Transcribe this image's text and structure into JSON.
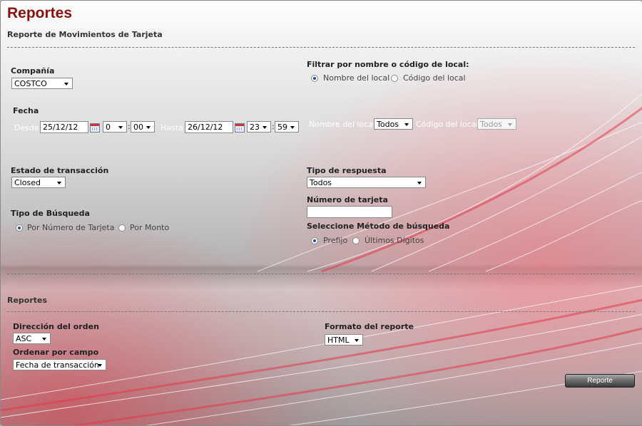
{
  "page": {
    "title": "Reportes",
    "subtitle": "Reporte de Movimientos de Tarjeta"
  },
  "company": {
    "label": "Compañía",
    "value": "COSTCO"
  },
  "local_filter": {
    "label": "Filtrar por nombre o código de local:",
    "options": [
      "Nombre del local",
      "Código del local"
    ],
    "selected": "Nombre del local",
    "name_label": "Nombre del local",
    "name_value": "Todos",
    "code_label": "Código del local",
    "code_value": "Todos"
  },
  "date": {
    "label": "Fecha",
    "from_label": "Desde",
    "from_date": "25/12/12",
    "from_hour": "0",
    "from_min": "00",
    "to_label": "Hasta",
    "to_date": "26/12/12",
    "to_hour": "23",
    "to_min": "59",
    "separator": ":"
  },
  "transaction_state": {
    "label": "Estado de transacción",
    "value": "Closed"
  },
  "response_type": {
    "label": "Tipo de respuesta",
    "value": "Todos"
  },
  "card_number": {
    "label": "Número de tarjeta",
    "value": ""
  },
  "search_type": {
    "label": "Tipo de Búsqueda",
    "options": [
      "Por Número de Tarjeta",
      "Por Monto"
    ],
    "selected": "Por Número de Tarjeta"
  },
  "search_method": {
    "label": "Seleccione Método de búsqueda",
    "options": [
      "Prefijo",
      "Últimos Dígitos"
    ],
    "selected": "Prefijo"
  },
  "reports": {
    "section_title": "Reportes",
    "order_direction": {
      "label": "Dirección del orden",
      "value": "ASC"
    },
    "order_field": {
      "label": "Ordenar por campo",
      "value": "Fecha de transacción"
    },
    "format": {
      "label": "Formato del reporte",
      "value": "HTML"
    },
    "button_label": "Reporte"
  },
  "colors": {
    "title": "#8a0f0f",
    "accent_red": "#e23b4a",
    "radio_dot": "#1c4f9c"
  }
}
